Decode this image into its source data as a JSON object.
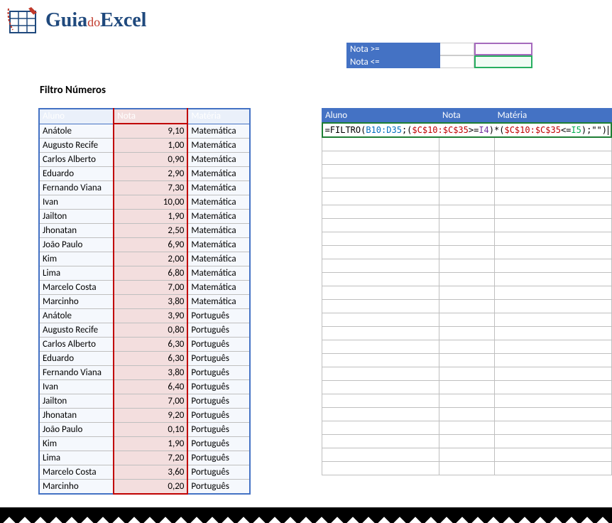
{
  "logo": {
    "guia": "Guia",
    "do": "do",
    "excel": "Excel"
  },
  "filters": {
    "nota_gte_label": "Nota >=",
    "nota_lte_label": "Nota <="
  },
  "section_title": "Filtro Números",
  "headers": {
    "aluno": "Aluno",
    "nota": "Nota",
    "materia": "Matéria"
  },
  "data": [
    {
      "aluno": "Anátole",
      "nota": "9,10",
      "materia": "Matemática"
    },
    {
      "aluno": "Augusto Recife",
      "nota": "1,00",
      "materia": "Matemática"
    },
    {
      "aluno": "Carlos Alberto",
      "nota": "0,90",
      "materia": "Matemática"
    },
    {
      "aluno": "Eduardo",
      "nota": "2,90",
      "materia": "Matemática"
    },
    {
      "aluno": "Fernando Viana",
      "nota": "7,30",
      "materia": "Matemática"
    },
    {
      "aluno": "Ivan",
      "nota": "10,00",
      "materia": "Matemática"
    },
    {
      "aluno": "Jailton",
      "nota": "1,90",
      "materia": "Matemática"
    },
    {
      "aluno": "Jhonatan",
      "nota": "2,50",
      "materia": "Matemática"
    },
    {
      "aluno": "João Paulo",
      "nota": "6,90",
      "materia": "Matemática"
    },
    {
      "aluno": "Kim",
      "nota": "2,00",
      "materia": "Matemática"
    },
    {
      "aluno": "Lima",
      "nota": "6,80",
      "materia": "Matemática"
    },
    {
      "aluno": "Marcelo Costa",
      "nota": "7,00",
      "materia": "Matemática"
    },
    {
      "aluno": "Marcinho",
      "nota": "3,80",
      "materia": "Matemática"
    },
    {
      "aluno": "Anátole",
      "nota": "3,90",
      "materia": "Português"
    },
    {
      "aluno": "Augusto Recife",
      "nota": "0,80",
      "materia": "Português"
    },
    {
      "aluno": "Carlos Alberto",
      "nota": "6,30",
      "materia": "Português"
    },
    {
      "aluno": "Eduardo",
      "nota": "6,30",
      "materia": "Português"
    },
    {
      "aluno": "Fernando Viana",
      "nota": "3,80",
      "materia": "Português"
    },
    {
      "aluno": "Ivan",
      "nota": "6,40",
      "materia": "Português"
    },
    {
      "aluno": "Jailton",
      "nota": "7,00",
      "materia": "Português"
    },
    {
      "aluno": "Jhonatan",
      "nota": "9,20",
      "materia": "Português"
    },
    {
      "aluno": "João Paulo",
      "nota": "0,10",
      "materia": "Português"
    },
    {
      "aluno": "Kim",
      "nota": "1,90",
      "materia": "Português"
    },
    {
      "aluno": "Lima",
      "nota": "7,20",
      "materia": "Português"
    },
    {
      "aluno": "Marcelo Costa",
      "nota": "3,60",
      "materia": "Português"
    },
    {
      "aluno": "Marcinho",
      "nota": "0,20",
      "materia": "Português"
    }
  ],
  "formula": {
    "prefix": "=FILTRO(",
    "range": "B10:D35",
    "sep1": ";(",
    "crange1": "$C$10:$C$35",
    "op1": ">=",
    "ref1": "I4",
    "mid": ")*(",
    "crange2": "$C$10:$C$35",
    "op2": "<=",
    "ref2": "I5",
    "end1": ");",
    "empty": "\"\"",
    "end2": ")"
  },
  "empty_rows": 25
}
